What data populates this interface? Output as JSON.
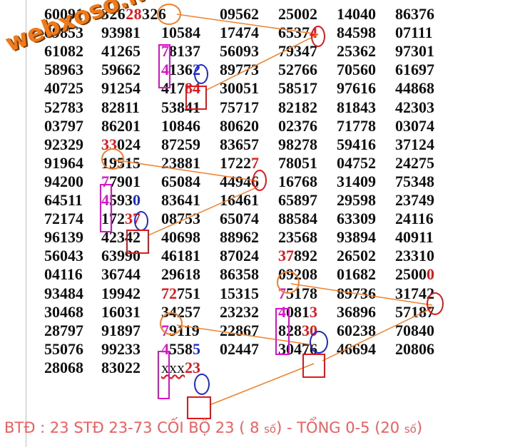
{
  "watermark": "webxoso.net",
  "rows": [
    [
      "60091",
      "32628326",
      "09562",
      "25002",
      "14040",
      "86376"
    ],
    [
      "69853",
      "93981",
      "10584",
      "17474",
      "65374",
      "84598",
      "07111"
    ],
    [
      "61082",
      "41265",
      "78137",
      "56093",
      "79347",
      "25362",
      "97301"
    ],
    [
      "58963",
      "59662",
      "41362",
      "89773",
      "52766",
      "70560",
      "61697"
    ],
    [
      "40725",
      "91254",
      "41784",
      "30051",
      "58517",
      "97616",
      "44868"
    ],
    [
      "52783",
      "82811",
      "53841",
      "75717",
      "82182",
      "81843",
      "42303"
    ],
    [
      "03797",
      "86201",
      "10846",
      "80620",
      "02376",
      "71778",
      "03074"
    ],
    [
      "92329",
      "33024",
      "87259",
      "83657",
      "98278",
      "59416",
      "37124"
    ],
    [
      "91964",
      "19515",
      "23881",
      "17227",
      "78051",
      "04752",
      "24275"
    ],
    [
      "94200",
      "77901",
      "65084",
      "44946",
      "16768",
      "31409",
      "75348"
    ],
    [
      "64511",
      "45930",
      "83641",
      "16461",
      "65897",
      "29598",
      "23749"
    ],
    [
      "72174",
      "17237",
      "08753",
      "65074",
      "88584",
      "63309",
      "24116"
    ],
    [
      "96139",
      "42342",
      "40698",
      "88962",
      "23568",
      "93894",
      "40911"
    ],
    [
      "56043",
      "63990",
      "46181",
      "87024",
      "37892",
      "26502",
      "23310"
    ],
    [
      "04116",
      "36744",
      "29618",
      "86358",
      "09208",
      "01682",
      "25000"
    ],
    [
      "93484",
      "19942",
      "72751",
      "15315",
      "75178",
      "89736",
      "31742"
    ],
    [
      "30468",
      "16031",
      "34257",
      "23232",
      "40813",
      "36896",
      "57187"
    ],
    [
      "28797",
      "91897",
      "79119",
      "22867",
      "82830",
      "60238",
      "70840"
    ],
    [
      "55076",
      "99233",
      "45585",
      "02447",
      "30476",
      "46694",
      "20806"
    ],
    [
      "28068",
      "83022",
      "xxx23"
    ]
  ],
  "footer": {
    "part1": "BTĐ : 23 STĐ 23-73 CỐI BỘ 23 ( 8 ",
    "so1": "số",
    "part2": ") - TỔNG 0-5 (20 ",
    "so2": "số",
    "part3": ")"
  },
  "colors": {
    "highlight_red": "#e0181c",
    "highlight_magenta": "#e010d0",
    "highlight_blue": "#1a2bd0",
    "watermark_orange": "#f07a1a",
    "footer_text": "#f25c5c"
  }
}
